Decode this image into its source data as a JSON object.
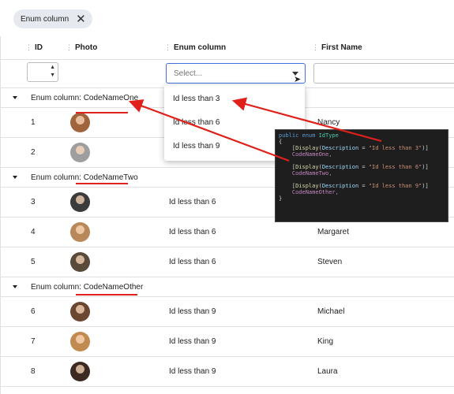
{
  "group_panel": {
    "chip_label": "Enum column"
  },
  "header": {
    "id": "ID",
    "photo": "Photo",
    "enum": "Enum column",
    "first_name": "First Name"
  },
  "filter": {
    "select_placeholder": "Select..."
  },
  "dropdown": {
    "options": [
      "Id less than 3",
      "Id less than 6",
      "Id less than 9"
    ]
  },
  "groups": [
    {
      "prefix": "Enum column: ",
      "value": "CodeNameOne"
    },
    {
      "prefix": "Enum column: ",
      "value": "CodeNameTwo"
    },
    {
      "prefix": "Enum column: ",
      "value": "CodeNameOther"
    }
  ],
  "rows": [
    {
      "id": "1",
      "enum": "",
      "first_name": "Nancy",
      "avatar_color": "#a0643c"
    },
    {
      "id": "2",
      "enum": "",
      "first_name": "",
      "avatar_color": "#9e9e9e"
    },
    {
      "id": "3",
      "enum": "Id less than 6",
      "first_name": "",
      "avatar_color": "#3b3b3b"
    },
    {
      "id": "4",
      "enum": "Id less than 6",
      "first_name": "Margaret",
      "avatar_color": "#b8875a"
    },
    {
      "id": "5",
      "enum": "Id less than 6",
      "first_name": "Steven",
      "avatar_color": "#5a4a3a"
    },
    {
      "id": "6",
      "enum": "Id less than 9",
      "first_name": "Michael",
      "avatar_color": "#6b4630"
    },
    {
      "id": "7",
      "enum": "Id less than 9",
      "first_name": "King",
      "avatar_color": "#c08a50"
    },
    {
      "id": "8",
      "enum": "Id less than 9",
      "first_name": "Laura",
      "avatar_color": "#3c2a22"
    }
  ],
  "code": {
    "line1_kw": "public enum ",
    "line1_type": "IdType",
    "open_brace": "{",
    "close_brace": "}",
    "entries": [
      {
        "attr": "Display",
        "prop": "Description",
        "eq": " = ",
        "str": "\"Id less than 3\"",
        "member": "CodeNameOne,"
      },
      {
        "attr": "Display",
        "prop": "Description",
        "eq": " = ",
        "str": "\"Id less than 6\"",
        "member": "CodeNameTwo,"
      },
      {
        "attr": "Display",
        "prop": "Description",
        "eq": " = ",
        "str": "\"Id less than 9\"",
        "member": "CodeNameOther,"
      }
    ]
  },
  "colors": {
    "annotation_red": "#e0201a",
    "focus_blue": "#3f6fd8"
  }
}
